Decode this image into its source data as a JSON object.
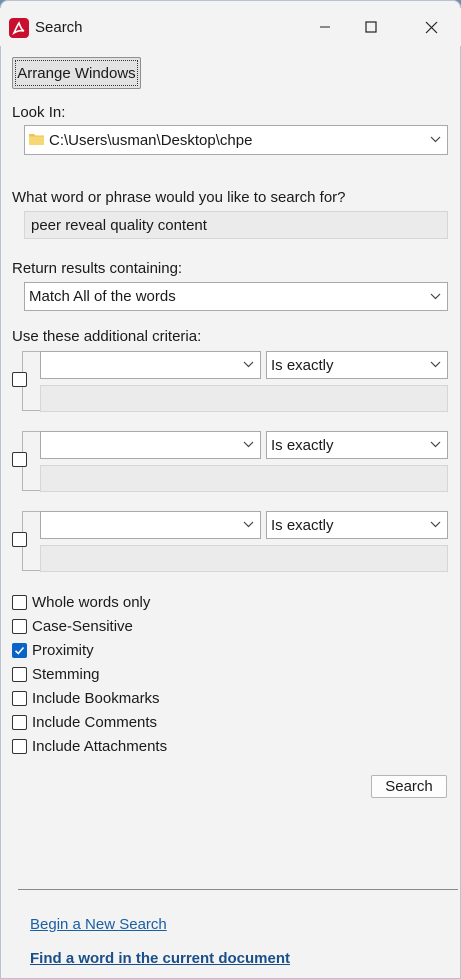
{
  "window": {
    "title": "Search",
    "app_icon": "acrobat-icon"
  },
  "toolbar": {
    "arrange_windows_label": "Arrange Windows"
  },
  "look_in": {
    "label": "Look In:",
    "value": "C:\\Users\\usman\\Desktop\\chpe",
    "icon": "folder-icon"
  },
  "query": {
    "label": "What word or phrase would you like to search for?",
    "value": "peer reveal quality content"
  },
  "return_results": {
    "label": "Return results containing:",
    "value": "Match All of the words"
  },
  "criteria": {
    "label": "Use these additional criteria:",
    "rows": [
      {
        "field": "",
        "operator": "Is exactly",
        "value": "",
        "checked": false
      },
      {
        "field": "",
        "operator": "Is exactly",
        "value": "",
        "checked": false
      },
      {
        "field": "",
        "operator": "Is exactly",
        "value": "",
        "checked": false
      }
    ]
  },
  "options": [
    {
      "label": "Whole words only",
      "checked": false
    },
    {
      "label": "Case-Sensitive",
      "checked": false
    },
    {
      "label": "Proximity",
      "checked": true
    },
    {
      "label": "Stemming",
      "checked": false
    },
    {
      "label": "Include Bookmarks",
      "checked": false
    },
    {
      "label": "Include Comments",
      "checked": false
    },
    {
      "label": "Include Attachments",
      "checked": false
    }
  ],
  "search_button_label": "Search",
  "links": {
    "new_search": "Begin a New Search",
    "find_in_document": "Find a word in the current document"
  },
  "colors": {
    "accent": "#0a63c7",
    "link": "#1a5ea3",
    "app_icon": "#c8102e"
  }
}
